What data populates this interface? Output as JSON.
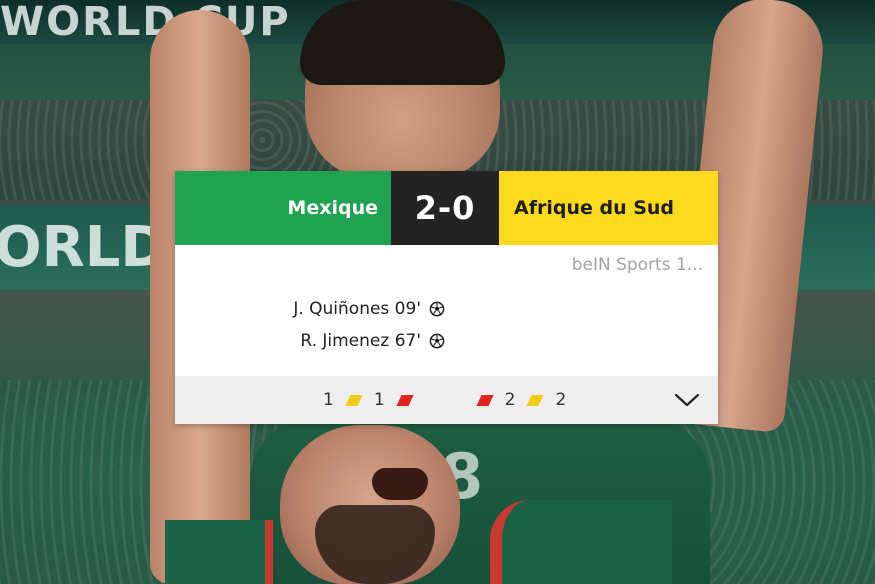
{
  "background": {
    "banner_top_text": "WORLD CUP",
    "banner_mid_text": "ORLD",
    "shirt_number": "8"
  },
  "match": {
    "home_team": "Mexique",
    "away_team": "Afrique du Sud",
    "score": "2-0",
    "broadcaster": "beIN Sports 1...",
    "colors": {
      "home": "#1fa351",
      "score_bg": "#232323",
      "away": "#fbd91c",
      "yellow_card": "#f2cb16",
      "red_card": "#e0241b"
    },
    "scorers": [
      {
        "label": "J. Quiñones 09'",
        "icon": "soccer-ball-icon"
      },
      {
        "label": "R. Jimenez 67'",
        "icon": "soccer-ball-icon"
      }
    ],
    "cards": {
      "home_yellow": "1",
      "home_red": "1",
      "away_red": "2",
      "away_yellow": "2"
    },
    "expand_icon": "chevron-down-icon"
  }
}
